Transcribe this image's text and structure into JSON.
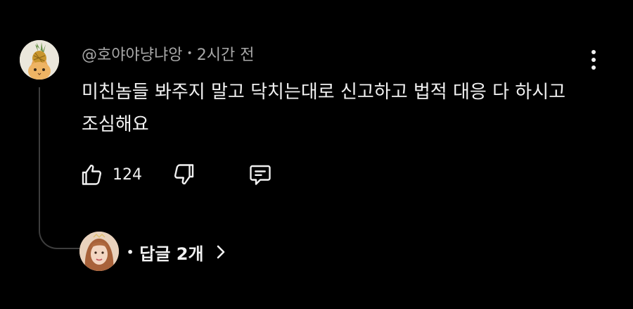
{
  "comment": {
    "author": "@호야야냥냐앙",
    "separator": "•",
    "timestamp": "2시간 전",
    "text": "미친놈들 봐주지 말고 닥치는대로 신고하고 법적 대응 다 하시고 조심해요",
    "like_count": "124"
  },
  "replies": {
    "separator": "•",
    "label": "답글 2개"
  },
  "colors": {
    "background": "#000000",
    "text": "#f1f1f1",
    "meta": "#a8a8a8",
    "thread_line": "#3d3d3d"
  },
  "icons": {
    "like": "thumbs-up-icon",
    "dislike": "thumbs-down-icon",
    "reply": "comment-icon",
    "more": "more-vertical-icon",
    "expand": "chevron-right-icon"
  }
}
